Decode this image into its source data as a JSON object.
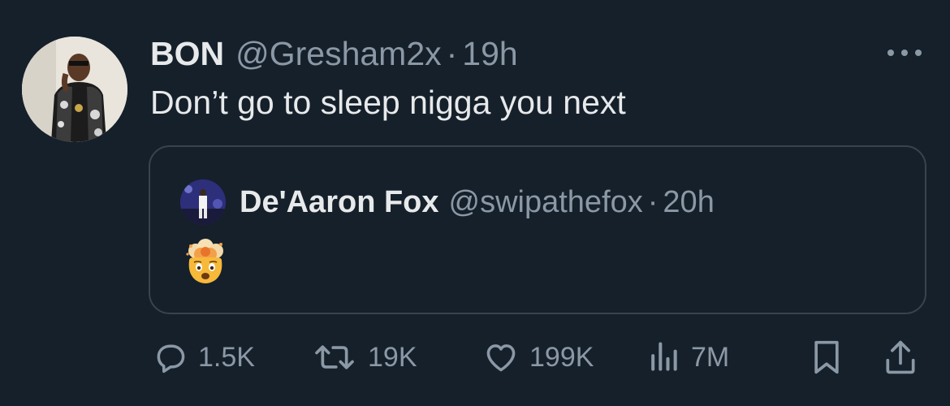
{
  "tweet": {
    "author_name": "BON",
    "author_handle": "@Gresham2x",
    "separator": "·",
    "time": "19h",
    "text": "Don’t go to sleep nigga you next"
  },
  "quoted_tweet": {
    "author_name": "De'Aaron Fox",
    "author_handle": "@swipathefox",
    "separator": "·",
    "time": "20h",
    "emoji_icon": "exploding-head-emoji"
  },
  "actions": {
    "replies": "1.5K",
    "retweets": "19K",
    "likes": "199K",
    "views": "7M"
  },
  "colors": {
    "background": "#15202b",
    "text_primary": "#e7e9ea",
    "text_secondary": "#8b98a5",
    "border": "#38444d"
  }
}
